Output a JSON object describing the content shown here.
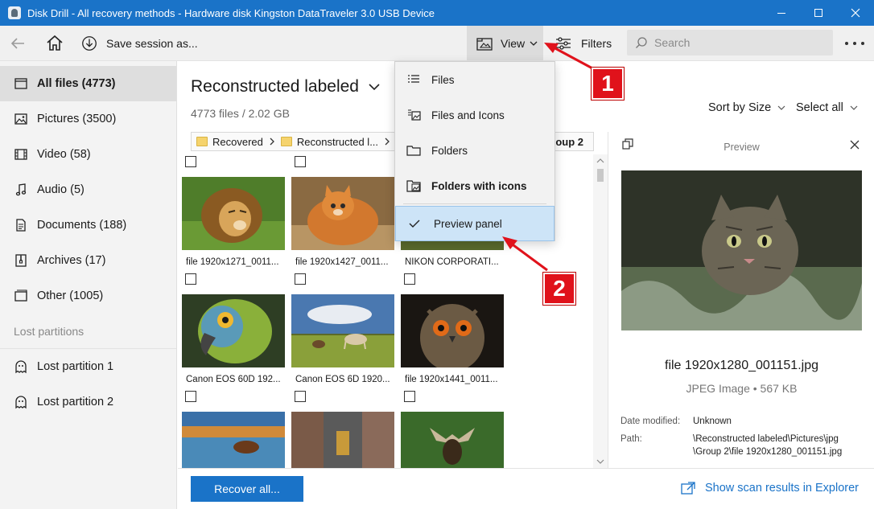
{
  "window": {
    "title": "Disk Drill - All recovery methods - Hardware disk Kingston DataTraveler 3.0 USB Device"
  },
  "toolbar": {
    "save_session": "Save session as...",
    "view": "View",
    "filters": "Filters",
    "search_placeholder": "Search"
  },
  "sidebar": {
    "items": [
      {
        "label": "All files (4773)",
        "icon": "all-files-icon",
        "active": true
      },
      {
        "label": "Pictures (3500)",
        "icon": "pictures-icon"
      },
      {
        "label": "Video (58)",
        "icon": "video-icon"
      },
      {
        "label": "Audio (5)",
        "icon": "audio-icon"
      },
      {
        "label": "Documents (188)",
        "icon": "documents-icon"
      },
      {
        "label": "Archives (17)",
        "icon": "archives-icon"
      },
      {
        "label": "Other (1005)",
        "icon": "other-icon"
      }
    ],
    "lost_section": "Lost partitions",
    "lost": [
      {
        "label": "Lost partition 1",
        "icon": "ghost-icon"
      },
      {
        "label": "Lost partition 2",
        "icon": "ghost-icon"
      }
    ]
  },
  "main": {
    "title": "Reconstructed labeled",
    "subtitle": "4773 files / 2.02 GB",
    "sort_by": "Sort by Size",
    "select_all": "Select all",
    "breadcrumb": [
      "Recovered",
      "Reconstructed l..."
    ],
    "breadcrumb_trail": "oup 2",
    "tiles": [
      {
        "caption": "file 1920x1271_0011..."
      },
      {
        "caption": "file 1920x1427_0011..."
      },
      {
        "caption": "NIKON CORPORATI..."
      },
      {
        "caption": "Canon EOS 60D 192..."
      },
      {
        "caption": "Canon EOS 6D 1920..."
      },
      {
        "caption": "file 1920x1441_0011..."
      },
      {
        "caption": ""
      },
      {
        "caption": ""
      },
      {
        "caption": ""
      }
    ]
  },
  "view_menu": {
    "items": [
      "Files",
      "Files and Icons",
      "Folders",
      "Folders with icons",
      "Preview panel"
    ],
    "checked": "Preview panel"
  },
  "preview": {
    "title": "Preview",
    "file_name": "file 1920x1280_001151.jpg",
    "file_type": "JPEG Image • 567 KB",
    "date_label": "Date modified:",
    "date_value": "Unknown",
    "path_label": "Path:",
    "path_line1": "\\Reconstructed labeled\\Pictures\\jpg",
    "path_line2": "\\Group 2\\file 1920x1280_001151.jpg"
  },
  "footer": {
    "recover": "Recover all...",
    "show_scan": "Show scan results in Explorer"
  },
  "annotations": {
    "badge1": "1",
    "badge2": "2"
  },
  "colors": {
    "accent": "#1a73c8",
    "annotation": "#e0121b"
  }
}
